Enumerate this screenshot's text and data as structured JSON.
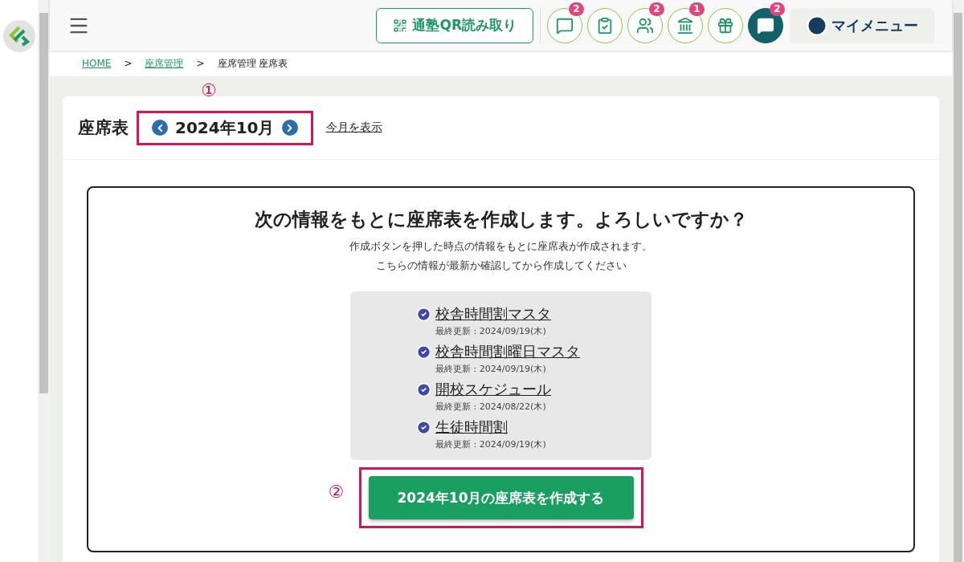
{
  "header": {
    "qr_button": "通塾QR読み取り",
    "icon_buttons": [
      {
        "kind": "chat",
        "badge": "2",
        "active": false
      },
      {
        "kind": "checklist",
        "active": false
      },
      {
        "kind": "group",
        "badge": "2",
        "active": false
      },
      {
        "kind": "school",
        "badge": "1",
        "active": false
      },
      {
        "kind": "gift",
        "active": false
      },
      {
        "kind": "message",
        "badge": "2",
        "active": true
      }
    ],
    "my_menu": "マイメニュー"
  },
  "breadcrumb": [
    {
      "label": "HOME",
      "link": true
    },
    {
      "label": "座席管理",
      "link": true
    },
    {
      "label": "座席管理 座席表",
      "link": false
    }
  ],
  "breadcrumb_separator": ">",
  "page": {
    "title": "座席表",
    "month": "2024年10月",
    "today_link": "今月を表示",
    "annotation": "①"
  },
  "confirm": {
    "heading": "次の情報をもとに座席表を作成します。よろしいですか？",
    "notes": [
      "作成ボタンを押した時点の情報をもとに座席表が作成されます。",
      "こちらの情報が最新か確認してから作成してください"
    ],
    "items": [
      {
        "name": "校舎時間割マスタ",
        "updated": "最終更新 : 2024/09/19(木)",
        "checked": true
      },
      {
        "name": "校舎時間割曜日マスタ",
        "updated": "最終更新 : 2024/09/19(木)",
        "checked": true
      },
      {
        "name": "開校スケジュール",
        "updated": "最終更新 : 2024/08/22(木)",
        "checked": true
      },
      {
        "name": "生徒時間割",
        "updated": "最終更新 : 2024/09/19(木)",
        "checked": true
      }
    ],
    "button": "2024年10月の座席表を作成する",
    "annotation": "②"
  }
}
